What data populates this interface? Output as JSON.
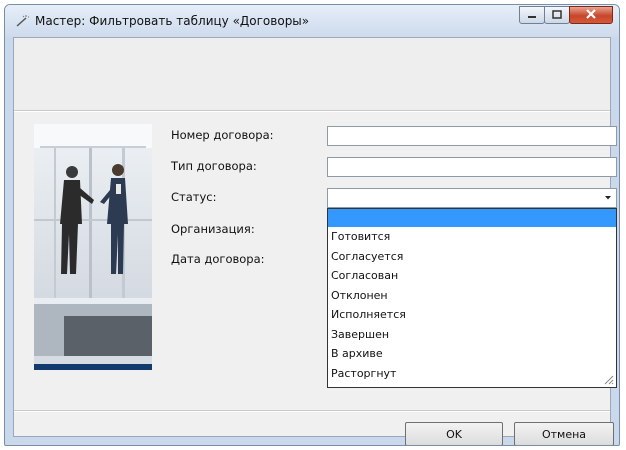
{
  "window": {
    "title": "Мастер: Фильтровать таблицу «Договоры»",
    "icons": {
      "app": "wand-icon",
      "minimize": "minimize-icon",
      "maximize": "maximize-icon",
      "close": "close-icon"
    }
  },
  "form": {
    "fields": [
      {
        "label": "Номер договора:",
        "value": ""
      },
      {
        "label": "Тип договора:",
        "value": ""
      },
      {
        "label": "Статус:",
        "value": ""
      },
      {
        "label": "Организация:"
      },
      {
        "label": "Дата договора:"
      }
    ]
  },
  "status_dropdown": {
    "options": [
      "",
      "Готовится",
      "Согласуется",
      "Согласован",
      "Отклонен",
      "Исполняется",
      "Завершен",
      "В архиве",
      "Расторгнут"
    ],
    "selected_index": 0,
    "icons": {
      "arrow": "chevron-down-icon",
      "grip": "resize-grip-icon"
    }
  },
  "buttons": {
    "ok": "OK",
    "cancel": "Отмена"
  },
  "colors": {
    "selection": "#3399ff",
    "close_button": "#c8452b",
    "image_bar": "#123a6e"
  }
}
